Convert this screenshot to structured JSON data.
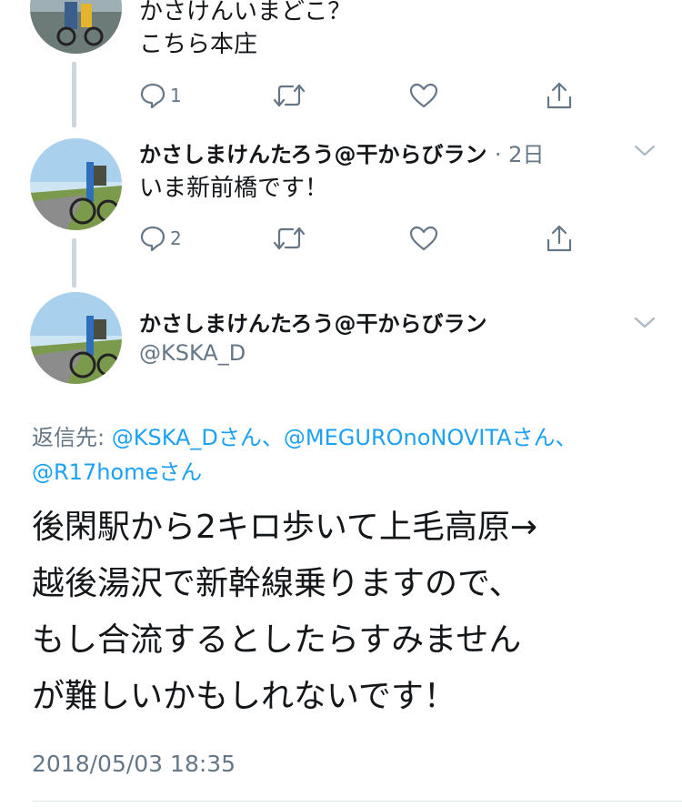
{
  "tweet_top": {
    "text_line1": "かさけんいまどこ？",
    "text_line2": "こちら本庄",
    "reply_count": "1"
  },
  "tweet_mid": {
    "name": "かさしまけんたろう@干からびラン",
    "time": "· 2日",
    "text": "いま新前橋です！",
    "reply_count": "2"
  },
  "tweet_main": {
    "name": "かさしまけんたろう@干からびラン",
    "handle": "@KSKA_D",
    "reply_prefix": "返信先: ",
    "reply_mention1": "@KSKA_Dさん、",
    "reply_mention2": "@MEGUROnoNOVITAさん、",
    "reply_mention3": "@R17homeさん",
    "body_line1": "後閑駅から2キロ歩いて上毛高原→",
    "body_line2": "越後湯沢で新幹線乗りますので、",
    "body_line3": "もし合流するとしたらすみません",
    "body_line4": "が難しいかもしれないです！",
    "timestamp": "2018/05/03 18:35"
  },
  "colors": {
    "text": "#14171a",
    "secondary": "#657786",
    "link": "#1da1f2",
    "thread_line": "#ccd6dd"
  },
  "icons": [
    "reply-icon",
    "retweet-icon",
    "like-icon",
    "share-icon",
    "chevron-down-icon"
  ]
}
